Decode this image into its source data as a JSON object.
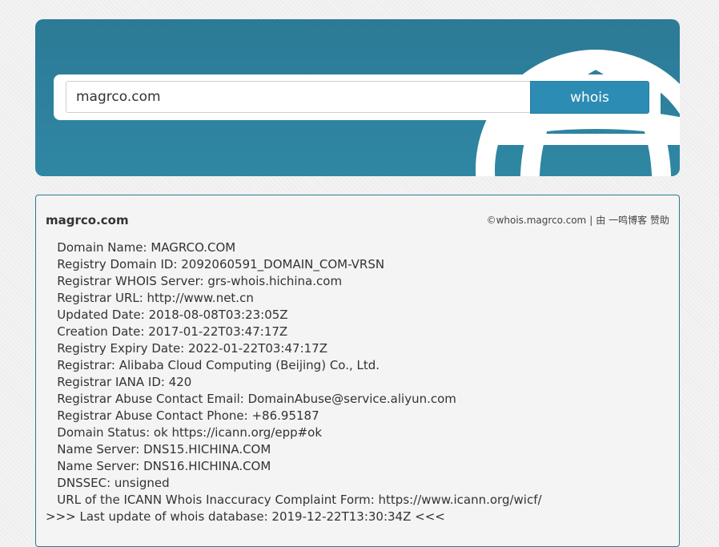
{
  "search": {
    "value": "magrco.com",
    "button_label": "whois"
  },
  "result": {
    "domain_title": "magrco.com",
    "credit": {
      "site": "©whois.magrco.com",
      "separator": "|",
      "by_label": "由",
      "author": "一鸣博客",
      "sponsor": "赞助"
    },
    "lines": [
      "   Domain Name: MAGRCO.COM",
      "   Registry Domain ID: 2092060591_DOMAIN_COM-VRSN",
      "   Registrar WHOIS Server: grs-whois.hichina.com",
      "   Registrar URL: http://www.net.cn",
      "   Updated Date: 2018-08-08T03:23:05Z",
      "   Creation Date: 2017-01-22T03:47:17Z",
      "   Registry Expiry Date: 2022-01-22T03:47:17Z",
      "   Registrar: Alibaba Cloud Computing (Beijing) Co., Ltd.",
      "   Registrar IANA ID: 420",
      "   Registrar Abuse Contact Email: DomainAbuse@service.aliyun.com",
      "   Registrar Abuse Contact Phone: +86.95187",
      "   Domain Status: ok https://icann.org/epp#ok",
      "   Name Server: DNS15.HICHINA.COM",
      "   Name Server: DNS16.HICHINA.COM",
      "   DNSSEC: unsigned",
      "   URL of the ICANN Whois Inaccuracy Complaint Form: https://www.icann.org/wicf/",
      ">>> Last update of whois database: 2019-12-22T13:30:34Z <<<"
    ]
  }
}
